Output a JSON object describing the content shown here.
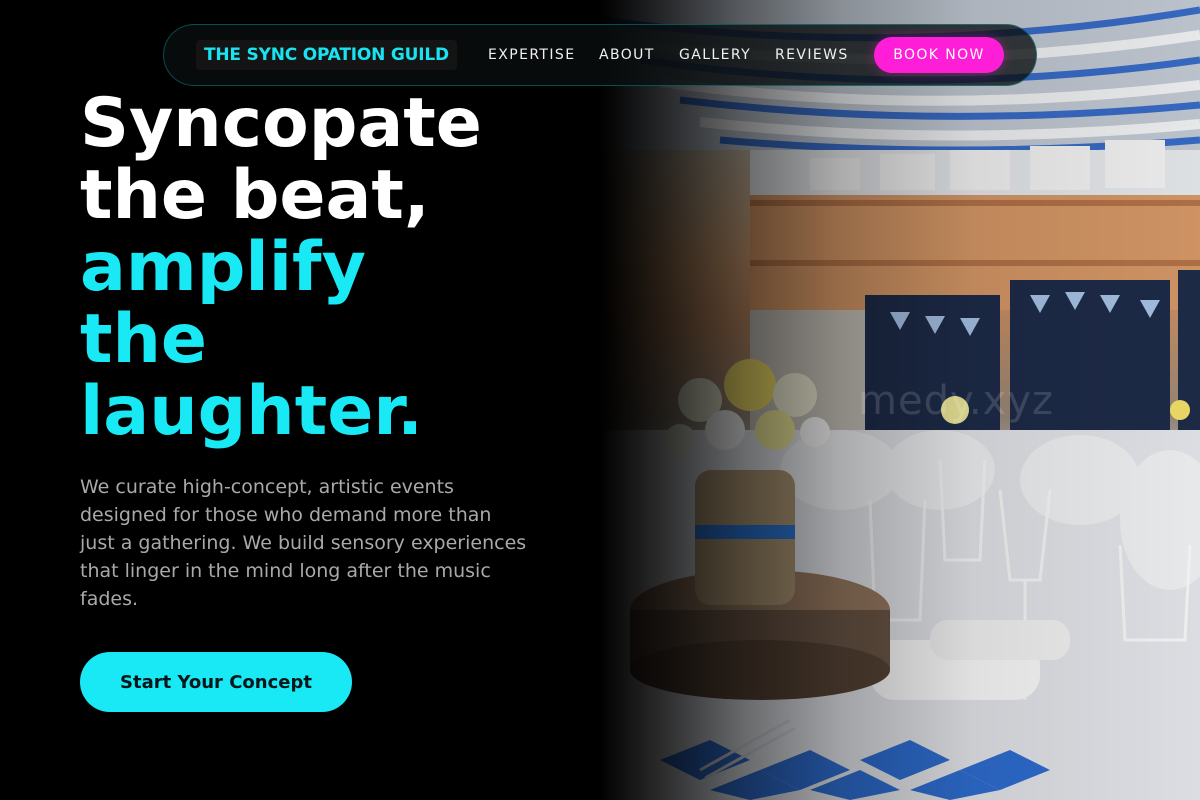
{
  "nav": {
    "brand": "THE SYNC OPATION GUILD",
    "links": [
      "EXPERTISE",
      "ABOUT",
      "GALLERY",
      "REVIEWS"
    ],
    "cta": "BOOK NOW"
  },
  "hero": {
    "headline_lines": [
      "Syncopate",
      "the beat,"
    ],
    "accent_lines": [
      "amplify",
      "the",
      "laughter."
    ],
    "description": "We curate high-concept, artistic events designed for those who demand more than just a gathering. We build sensory experiences that linger in the mind long after the music fades.",
    "cta": "Start Your Concept",
    "watermark": "medy.xyz"
  },
  "colors": {
    "accent_cyan": "#19e9f5",
    "accent_magenta": "#ff1ed8",
    "background": "#000000",
    "body_text": "#a9a9a9"
  }
}
